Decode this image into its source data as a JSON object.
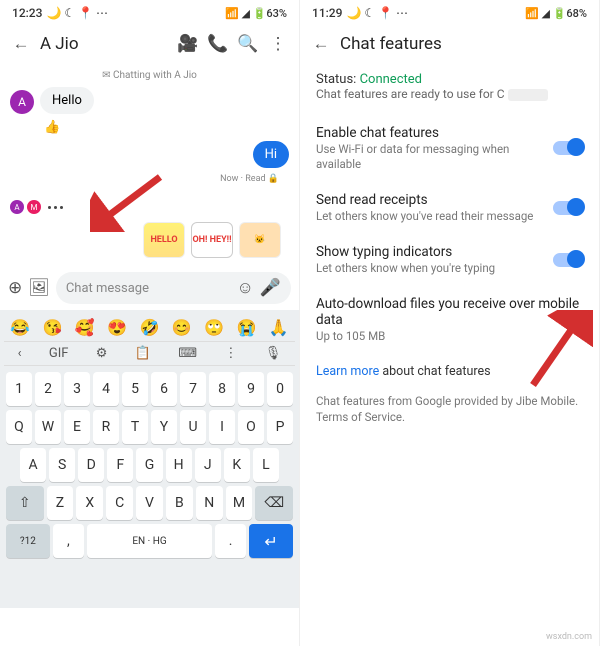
{
  "left": {
    "status": {
      "time": "12:23",
      "icons": "🌙 ☾ 📍 ⋯",
      "right": "📶 ◢ 🔋63%"
    },
    "header": {
      "title": "A Jio"
    },
    "messages": {
      "system": "✉ Chatting with A Jio",
      "in1": "Hello",
      "reaction": "👍",
      "out1": "Hi",
      "out1_meta": "Now · Read 🔒",
      "sticker1": "HELLO",
      "sticker2": "OH! HEY!!",
      "sticker3": "🐱"
    },
    "input": {
      "placeholder": "Chat message"
    },
    "keyboard": {
      "emojis": [
        "😂",
        "😘",
        "🥰",
        "😍",
        "🤣",
        "😊",
        "🙄",
        "😭",
        "🙏"
      ],
      "tools": [
        "‹",
        "GIF",
        "⚙",
        "📋",
        "⌨",
        "⋮",
        ""
      ],
      "row_nums": [
        "1",
        "2",
        "3",
        "4",
        "5",
        "6",
        "7",
        "8",
        "9",
        "0"
      ],
      "row1": [
        "Q",
        "W",
        "E",
        "R",
        "T",
        "Y",
        "U",
        "I",
        "O",
        "P"
      ],
      "row2": [
        "A",
        "S",
        "D",
        "F",
        "G",
        "H",
        "J",
        "K",
        "L"
      ],
      "row3_shift": "⇧",
      "row3": [
        "Z",
        "X",
        "C",
        "V",
        "B",
        "N",
        "M"
      ],
      "row3_bksp": "⌫",
      "row4": {
        "sym": "?12",
        "comma": ",",
        "lang": "EN · HG",
        "dot": ".",
        "enter": "↵"
      }
    }
  },
  "right": {
    "status": {
      "time": "11:29",
      "icons": "🌙 ☾ 📍 ⋯",
      "right": "📶 ◢ 🔋68%"
    },
    "header": {
      "title": "Chat features"
    },
    "conn": {
      "label": "Status:",
      "value": "Connected",
      "desc": "Chat features are ready to use for C"
    },
    "settings": [
      {
        "title": "Enable chat features",
        "desc": "Use Wi-Fi or data for messaging when available"
      },
      {
        "title": "Send read receipts",
        "desc": "Let others know you've read their message"
      },
      {
        "title": "Show typing indicators",
        "desc": "Let others know when you're typing"
      },
      {
        "title": "Auto-download files you receive over mobile data",
        "desc": "Up to 105 MB"
      }
    ],
    "learn": {
      "link": "Learn more",
      "rest": " about chat features"
    },
    "footer": "Chat features from Google provided by Jibe Mobile. Terms of Service."
  },
  "watermark": "wsxdn.com"
}
